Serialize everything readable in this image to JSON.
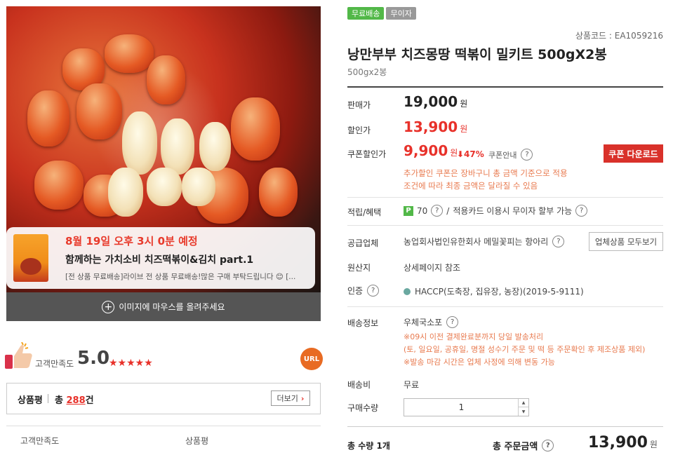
{
  "live_notice": {
    "schedule": "8월 19일 오후 3시 0분 예정",
    "title": "함께하는 가치소비 치즈떡볶이&김치 part.1",
    "description": "[전 상품 무료배송]라이브 전 상품 무료배송!많은 구매 부탁드립니다 😊 [..."
  },
  "image_hover_hint": "이미지에 마우스를 올려주세요",
  "satisfaction": {
    "label": "고객만족도",
    "score": "5.0",
    "stars": "★★★★★",
    "url_label": "URL"
  },
  "review": {
    "title": "상품평",
    "total_prefix": "총",
    "count": "288",
    "total_suffix": "건",
    "more_label": "더보기",
    "columns": [
      "고객만족도",
      "상품평"
    ]
  },
  "badges": [
    "무료배송",
    "무이자"
  ],
  "product": {
    "code": "상품코드 : EA1059216",
    "name": "낭만부부 치즈몽땅 떡볶이 밀키트 500gX2봉",
    "option": "500gx2봉"
  },
  "pricing": {
    "sale_label": "판매가",
    "sale_price": "19,000",
    "discount_label": "할인가",
    "discount_price": "13,900",
    "coupon_label": "쿠폰할인가",
    "coupon_price": "9,900",
    "coupon_rate": "⬇47%",
    "coupon_guide": "쿠폰안내",
    "coupon_button": "쿠폰 다운로드",
    "currency": "원",
    "coupon_notes": [
      "추가할인 쿠폰은 장바구니 총 금액 기준으로 적용",
      "조건에 따라 최종 금액은 달라질 수 있음"
    ]
  },
  "benefits": {
    "label": "적립/혜택",
    "points_icon": "P",
    "points": "70",
    "separator": "/",
    "card_note": "적용카드 이용시 무이자 할부 가능"
  },
  "supplier": {
    "label": "공급업체",
    "value": "농업회사법인유한회사 메밀꽃피는 항아리",
    "button": "업체상품 모두보기"
  },
  "origin": {
    "label": "원산지",
    "value": "상세페이지 참조"
  },
  "certification": {
    "label": "인증",
    "value": "HACCP(도축장, 집유장, 농장)(2019-5-9111)"
  },
  "shipping": {
    "label": "배송정보",
    "value": "우체국소포",
    "notes": [
      "※09시 이전 결제완료분까지 당일 발송처리",
      "(토, 일요일, 공휴일, 명절 성수기 주문 및 떡 등 주문확인 후 제조상품 제외)",
      "※발송 마감 시간은 업체 사정에 의해 변동 가능"
    ]
  },
  "shipping_fee": {
    "label": "배송비",
    "value": "무료"
  },
  "quantity": {
    "label": "구매수량",
    "value": "1",
    "up": "▲",
    "down": "▼"
  },
  "total": {
    "qty_label": "총 수량 1개",
    "amount_label": "총 주문금액",
    "amount": "13,900",
    "currency": "원"
  },
  "help_glyph": "?",
  "colors": {
    "accent_red": "#e8312a",
    "coupon_button": "#d9312a",
    "badge_green": "#52b848",
    "note_orange": "#e87a4f"
  }
}
